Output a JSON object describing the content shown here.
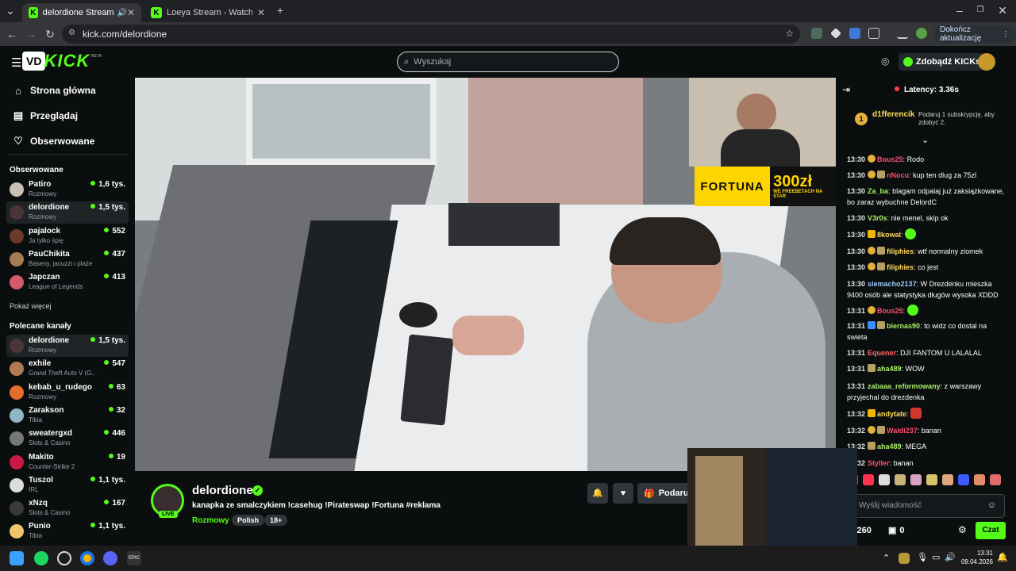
{
  "browser": {
    "tabs": [
      {
        "title": "delordione Stream - Watch"
      },
      {
        "title": "Loeya Stream - Watch Live on"
      }
    ],
    "url": "kick.com/delordione",
    "update_label": "Dokończ aktualizację"
  },
  "header": {
    "logo_letters": "VD",
    "logo_text": "KICK",
    "beta": "BETA",
    "search_placeholder": "Wyszukaj",
    "kicks_label": "Zdobądź KICKs"
  },
  "sidebar": {
    "nav": [
      {
        "label": "Strona główna",
        "icon": "home-icon"
      },
      {
        "label": "Przeglądaj",
        "icon": "browse-icon"
      },
      {
        "label": "Obserwowane",
        "icon": "heart-icon"
      }
    ],
    "followed_title": "Obserwowane",
    "followed": [
      {
        "name": "Patiro",
        "category": "Rozmowy",
        "viewers": "1,6 tys.",
        "color": "#c9c1b3"
      },
      {
        "name": "delordione",
        "category": "Rozmowy",
        "viewers": "1,5 tys.",
        "color": "#4a3438"
      },
      {
        "name": "pajalock",
        "category": "Ja tylko śpię",
        "viewers": "552",
        "color": "#6b3a2a"
      },
      {
        "name": "PauChikita",
        "category": "Baseny, jacuzzi i plaże",
        "viewers": "437",
        "color": "#a57d54"
      },
      {
        "name": "Japczan",
        "category": "League of Legends",
        "viewers": "413",
        "color": "#d55b6a"
      }
    ],
    "show_more": "Pokaż więcej",
    "recommended_title": "Polecane kanały",
    "recommended": [
      {
        "name": "delordione",
        "category": "Rozmowy",
        "viewers": "1,5 tys.",
        "color": "#4a3438"
      },
      {
        "name": "exhile",
        "category": "Grand Theft Auto V (G...",
        "viewers": "547",
        "color": "#b07a52"
      },
      {
        "name": "kebab_u_rudego",
        "category": "Rozmowy",
        "viewers": "63",
        "color": "#e46d2b"
      },
      {
        "name": "Zarakson",
        "category": "Tibia",
        "viewers": "32",
        "color": "#8fb6c4"
      },
      {
        "name": "sweatergxd",
        "category": "Slots & Casino",
        "viewers": "446",
        "color": "#777777"
      },
      {
        "name": "Makito",
        "category": "Counter-Strike 2",
        "viewers": "19",
        "color": "#c81a45"
      },
      {
        "name": "Tuszol",
        "category": "IRL",
        "viewers": "1,1 tys.",
        "color": "#dcdcdc"
      },
      {
        "name": "xNzq",
        "category": "Slots & Casino",
        "viewers": "167",
        "color": "#3a3a3a"
      },
      {
        "name": "Punio",
        "category": "Tibia",
        "viewers": "1,1 tys.",
        "color": "#f0c46a"
      }
    ]
  },
  "overlay": {
    "fortuna_brand": "FORTUNA",
    "fortuna_amount": "300zł",
    "fortuna_text": "WE FREEBETACH NA STAR"
  },
  "stream": {
    "streamer": "delordione",
    "live": "LIVE",
    "title": "kanapka ze smalczykiem !casehug !Pirateswap !Fortuna #reklama",
    "category": "Rozmowy",
    "tags": [
      "Polish",
      "18+"
    ],
    "gift_label": "Podaruj"
  },
  "chat": {
    "latency": "Latency: 3.36s",
    "pinned_user": "d1fferencik",
    "pinned_count": "1",
    "pinned_info": "Podaruj 1 subskrypcję, aby zdobyć 2.",
    "messages": [
      {
        "time": "13:30",
        "user": "Bous25",
        "color": "#ff4d6d",
        "text": "Rodo"
      },
      {
        "time": "13:30",
        "user": "nNocu",
        "color": "#ff4d6d",
        "text": "kup ten dlug za 75zl"
      },
      {
        "time": "13:30",
        "user": "Za_ba",
        "color": "#a8f06b",
        "text": "blagam odpalaj już zaksiążkowane, bo zaraz wybuchne DelordC"
      },
      {
        "time": "13:30",
        "user": "V3r0s",
        "color": "#a8f06b",
        "text": "nie menel, skip ok"
      },
      {
        "time": "13:30",
        "user": "8kowal",
        "color": "#ffdd55",
        "text": ""
      },
      {
        "time": "13:30",
        "user": "filiphies",
        "color": "#ffdd55",
        "text": "wtf normalny ziomek"
      },
      {
        "time": "13:30",
        "user": "filiphies",
        "color": "#ffdd55",
        "text": "co jest"
      },
      {
        "time": "13:30",
        "user": "siemacho2137",
        "color": "#9ecbff",
        "text": "W Drezdenku mieszka 9400 osób ale statystyka długów wysoka XDDD"
      },
      {
        "time": "13:31",
        "user": "Bous25",
        "color": "#ff4d6d",
        "text": ""
      },
      {
        "time": "13:31",
        "user": "biernas90",
        "color": "#a8f06b",
        "text": "to widz co dostal na swieta"
      },
      {
        "time": "13:31",
        "user": "Equener",
        "color": "#ff6b6b",
        "text": "DJI FANTOM U LALALAL"
      },
      {
        "time": "13:31",
        "user": "aha489",
        "color": "#a8f06b",
        "text": "WOW"
      },
      {
        "time": "13:31",
        "user": "zabaaa_reformowany",
        "color": "#a8f06b",
        "text": "z warszawy przyjechal do drezdenka"
      },
      {
        "time": "13:32",
        "user": "andytate",
        "color": "#ffdd55",
        "text": ""
      },
      {
        "time": "13:32",
        "user": "Waldi237",
        "color": "#ff4d6d",
        "text": "banan"
      },
      {
        "time": "13:32",
        "user": "aha489",
        "color": "#a8f06b",
        "text": "MEGA"
      },
      {
        "time": "13:32",
        "user": "Styller",
        "color": "#ff4d6d",
        "text": "banan"
      }
    ],
    "input_placeholder": "Wyślij wiadomość",
    "points": "260",
    "gifts": "0",
    "send_label": "Czat"
  },
  "taskbar": {
    "time": "13:31",
    "date": "09.04.2026"
  }
}
